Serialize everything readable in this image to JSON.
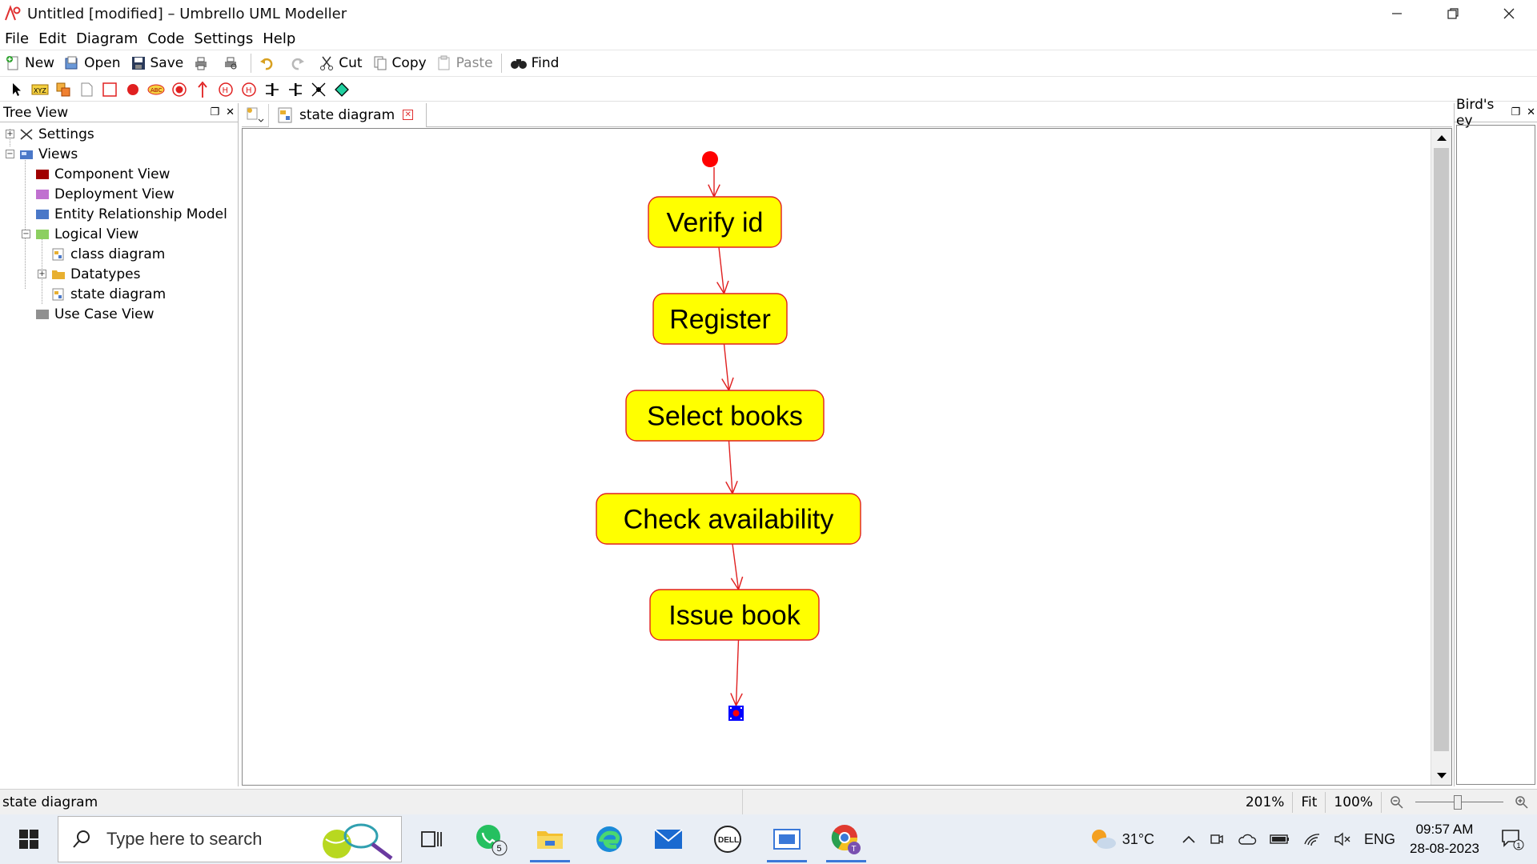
{
  "window": {
    "title": "Untitled [modified] – Umbrello UML Modeller",
    "minimize": "—",
    "maximize": "❐",
    "close": "✕"
  },
  "menu": [
    "File",
    "Edit",
    "Diagram",
    "Code",
    "Settings",
    "Help"
  ],
  "toolbar": {
    "new": "New",
    "open": "Open",
    "save": "Save",
    "cut": "Cut",
    "copy": "Copy",
    "paste": "Paste",
    "find": "Find"
  },
  "tree_panel": {
    "title": "Tree View",
    "items": [
      {
        "label": "Settings",
        "icon": "settings-icon"
      },
      {
        "label": "Views",
        "icon": "views-folder-icon"
      },
      {
        "label": "Component View",
        "icon": "component-view-icon",
        "color": "#a00000"
      },
      {
        "label": "Deployment View",
        "icon": "deployment-view-icon",
        "color": "#c070d0"
      },
      {
        "label": "Entity Relationship Model",
        "icon": "entity-model-icon",
        "color": "#4a78c8"
      },
      {
        "label": "Logical View",
        "icon": "logical-view-icon",
        "color": "#8ccf60"
      },
      {
        "label": "class diagram",
        "icon": "diagram-icon"
      },
      {
        "label": "Datatypes",
        "icon": "folder-icon",
        "color": "#e8b030"
      },
      {
        "label": "state diagram",
        "icon": "diagram-icon"
      },
      {
        "label": "Use Case View",
        "icon": "use-case-view-icon",
        "color": "#909090"
      }
    ]
  },
  "tab": {
    "label": "state diagram"
  },
  "diagram": {
    "states": [
      "Verify id",
      "Register",
      "Select books",
      "Check availability",
      "Issue book"
    ],
    "colors": {
      "fill": "#ffff00",
      "line": "#e02020",
      "initial": "#ff0000",
      "final": "#0000ff"
    }
  },
  "birds_eye": {
    "title": "Bird's ey"
  },
  "status": {
    "left": "state diagram",
    "zoom": "201%",
    "fit": "Fit",
    "hundred": "100%"
  },
  "taskbar": {
    "search_placeholder": "Type here to search",
    "whatsapp_badge": "5",
    "chrome_badge": "T",
    "temperature": "31°C",
    "lang": "ENG",
    "time": "09:57 AM",
    "date": "28-08-2023",
    "notif_count": "1"
  }
}
